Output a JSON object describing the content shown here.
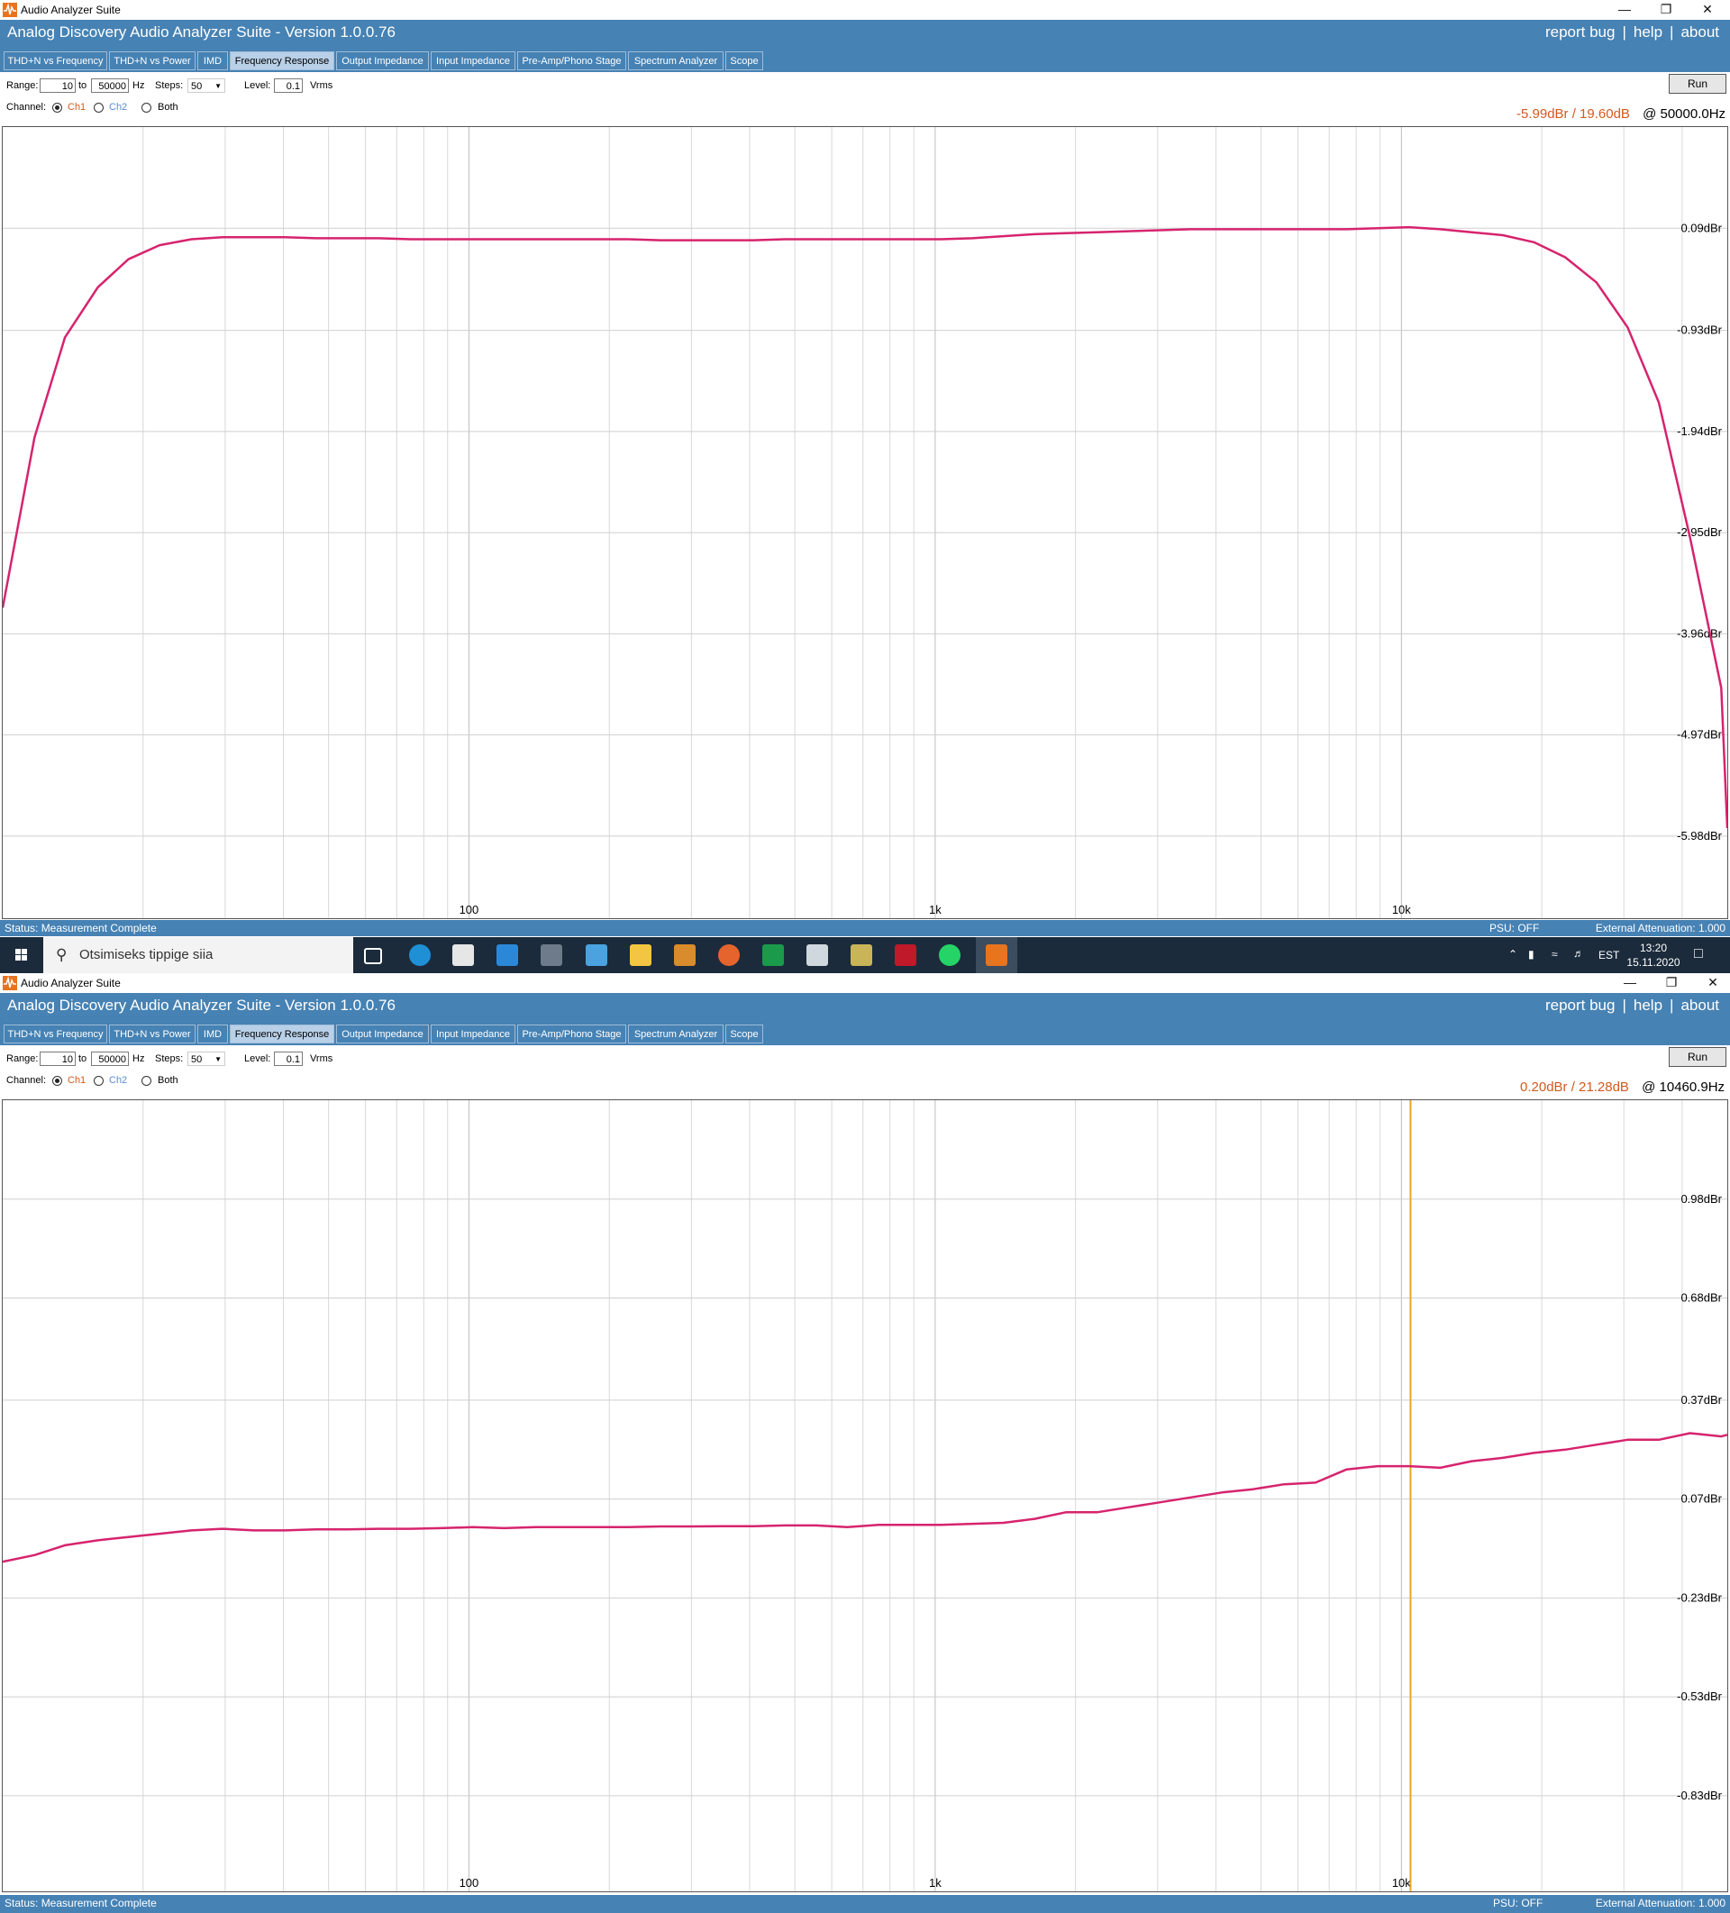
{
  "windows": [
    {
      "title_bar": "Audio Analyzer Suite",
      "app_title": "Analog Discovery Audio Analyzer Suite - Version   1.0.0.76",
      "links": [
        "report bug",
        "|",
        "help",
        "|",
        "about"
      ],
      "tabs": [
        "THD+N vs Frequency",
        "THD+N vs Power",
        "IMD",
        "Frequency Response",
        "Output Impedance",
        "Input Impedance",
        "Pre-Amp/Phono Stage",
        "Spectrum Analyzer",
        "Scope"
      ],
      "active_tab": 3,
      "controls": {
        "range_label": "Range:",
        "range_from": "10",
        "to_label": "to",
        "range_to": "50000",
        "hz_label": "Hz",
        "steps_label": "Steps:",
        "steps_value": "50",
        "level_label": "Level:",
        "level_value": "0.1",
        "level_unit": "Vrms",
        "channel_label": "Channel:",
        "ch1": "Ch1",
        "ch2": "Ch2",
        "both": "Both",
        "run_label": "Run"
      },
      "readout": {
        "value": "-5.99dBr / 19.60dB",
        "freq": "@ 50000.0Hz"
      },
      "status": {
        "text": "Status: Measurement Complete",
        "psu": "PSU: OFF",
        "attenuation": "External Attenuation: 1.000"
      },
      "chart_data": {
        "type": "line",
        "x_scale": "log",
        "xlim": [
          10,
          50000
        ],
        "x_tick_labels": [
          {
            "x": 100,
            "label": "100"
          },
          {
            "x": 1000,
            "label": "1k"
          },
          {
            "x": 10000,
            "label": "10k"
          }
        ],
        "y_ticks": [
          0.09,
          -0.93,
          -1.94,
          -2.95,
          -3.96,
          -4.97,
          -5.98
        ],
        "y_tick_labels": [
          "0.09dBr",
          "-0.93dBr",
          "-1.94dBr",
          "-2.95dBr",
          "-3.96dBr",
          "-4.97dBr",
          "-5.98dBr"
        ],
        "ylim": [
          -6.8,
          1.1
        ],
        "color": "#d6246e",
        "series": [
          {
            "x": [
              10,
              11.7,
              13.6,
              16,
              18.6,
              21.7,
              25.4,
              29.6,
              34.6,
              40.3,
              47,
              55,
              64,
              75,
              87,
              102,
              119,
              139,
              162,
              189,
              220,
              257,
              300,
              350,
              408,
              476,
              556,
              648,
              756,
              882,
              1029,
              1200,
              1400,
              1634,
              1906,
              2224,
              2594,
              3027,
              3531,
              4120,
              4806,
              5607,
              6542,
              7632,
              8904,
              10388,
              12119,
              14139,
              16496,
              19245,
              22453,
              26195,
              30561,
              35655,
              41598,
              48533,
              50000
            ],
            "y": [
              -3.7,
              -2.0,
              -1.0,
              -0.5,
              -0.22,
              -0.08,
              -0.02,
              0.0,
              0.0,
              0.0,
              -0.01,
              -0.01,
              -0.01,
              -0.02,
              -0.02,
              -0.02,
              -0.02,
              -0.02,
              -0.02,
              -0.02,
              -0.02,
              -0.03,
              -0.03,
              -0.03,
              -0.03,
              -0.02,
              -0.02,
              -0.02,
              -0.02,
              -0.02,
              -0.02,
              -0.01,
              0.01,
              0.03,
              0.04,
              0.05,
              0.06,
              0.07,
              0.08,
              0.08,
              0.08,
              0.08,
              0.08,
              0.08,
              0.09,
              0.1,
              0.08,
              0.05,
              0.02,
              -0.05,
              -0.2,
              -0.45,
              -0.9,
              -1.65,
              -3.0,
              -4.5,
              -5.9
            ]
          }
        ]
      }
    },
    {
      "title_bar": "Audio Analyzer Suite",
      "app_title": "Analog Discovery Audio Analyzer Suite - Version   1.0.0.76",
      "links": [
        "report bug",
        "|",
        "help",
        "|",
        "about"
      ],
      "tabs": [
        "THD+N vs Frequency",
        "THD+N vs Power",
        "IMD",
        "Frequency Response",
        "Output Impedance",
        "Input Impedance",
        "Pre-Amp/Phono Stage",
        "Spectrum Analyzer",
        "Scope"
      ],
      "active_tab": 3,
      "controls": {
        "range_label": "Range:",
        "range_from": "10",
        "to_label": "to",
        "range_to": "50000",
        "hz_label": "Hz",
        "steps_label": "Steps:",
        "steps_value": "50",
        "level_label": "Level:",
        "level_value": "0.1",
        "level_unit": "Vrms",
        "channel_label": "Channel:",
        "ch1": "Ch1",
        "ch2": "Ch2",
        "both": "Both",
        "run_label": "Run"
      },
      "readout": {
        "value": "0.20dBr / 21.28dB",
        "freq": "@ 10460.9Hz"
      },
      "status": {
        "text": "Status: Measurement Complete",
        "psu": "PSU: OFF",
        "attenuation": "External Attenuation: 1.000"
      },
      "chart_data": {
        "type": "line",
        "x_scale": "log",
        "xlim": [
          10,
          50000
        ],
        "x_tick_labels": [
          {
            "x": 100,
            "label": "100"
          },
          {
            "x": 1000,
            "label": "1k"
          },
          {
            "x": 10000,
            "label": "10k"
          }
        ],
        "y_ticks": [
          0.98,
          0.68,
          0.37,
          0.07,
          -0.23,
          -0.53,
          -0.83
        ],
        "y_tick_labels": [
          "0.98dBr",
          "0.68dBr",
          "0.37dBr",
          "0.07dBr",
          "-0.23dBr",
          "-0.53dBr",
          "-0.83dBr"
        ],
        "ylim": [
          -1.12,
          1.28
        ],
        "color": "#d6246e",
        "cursor_x": 10460.9,
        "cursor_color": "#e8a820",
        "series": [
          {
            "x": [
              10,
              11.7,
              13.6,
              16,
              18.6,
              21.7,
              25.4,
              29.6,
              34.6,
              40.3,
              47,
              55,
              64,
              75,
              87,
              102,
              119,
              139,
              162,
              189,
              220,
              257,
              300,
              350,
              408,
              476,
              556,
              648,
              756,
              882,
              1029,
              1200,
              1400,
              1634,
              1906,
              2224,
              2594,
              3027,
              3531,
              4120,
              4806,
              5607,
              6542,
              7632,
              8904,
              10388,
              12119,
              14139,
              16496,
              19245,
              22453,
              26195,
              30561,
              35655,
              41598,
              48533,
              50000
            ],
            "y": [
              -0.12,
              -0.1,
              -0.07,
              -0.055,
              -0.045,
              -0.035,
              -0.025,
              -0.02,
              -0.025,
              -0.025,
              -0.022,
              -0.022,
              -0.02,
              -0.02,
              -0.018,
              -0.015,
              -0.018,
              -0.015,
              -0.015,
              -0.015,
              -0.015,
              -0.013,
              -0.013,
              -0.012,
              -0.012,
              -0.01,
              -0.01,
              -0.015,
              -0.008,
              -0.008,
              -0.008,
              -0.005,
              -0.002,
              0.01,
              0.03,
              0.03,
              0.045,
              0.06,
              0.075,
              0.09,
              0.1,
              0.115,
              0.12,
              0.16,
              0.17,
              0.17,
              0.165,
              0.185,
              0.195,
              0.21,
              0.22,
              0.235,
              0.25,
              0.25,
              0.27,
              0.26,
              0.265
            ]
          }
        ]
      }
    }
  ],
  "taskbar": {
    "search_placeholder": "Otsimiseks tippige siia",
    "language": "EST",
    "time": "13:20",
    "date": "15.11.2020",
    "pinned_icons": [
      "task-view-icon",
      "edge-icon",
      "store-icon",
      "mail-icon",
      "calculator-icon",
      "photos-icon",
      "file-explorer-icon",
      "paint-icon",
      "firefox-icon",
      "w-app-icon",
      "fox-app-icon",
      "calendar-app-icon",
      "red-app-icon",
      "whatsapp-icon",
      "audio-analyzer-icon"
    ]
  }
}
